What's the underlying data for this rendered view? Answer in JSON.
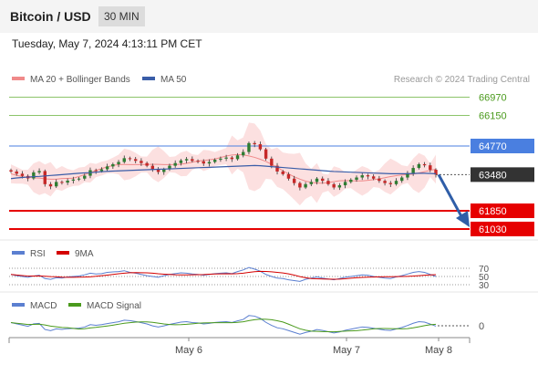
{
  "header": {
    "title": "Bitcoin / USD",
    "timeframe": "30 MIN"
  },
  "datetime": "Tuesday, May 7, 2024 4:13:11 PM CET",
  "legend": [
    {
      "label": "MA 20 + Bollinger Bands",
      "color": "#f08a8a"
    },
    {
      "label": "MA 50",
      "color": "#3a5da8"
    }
  ],
  "watermark": "Research © 2024 Trading Central",
  "chart_data": {
    "type": "candlestick",
    "current_price": 63480,
    "levels": [
      {
        "value": 66970,
        "kind": "resistance",
        "color": "#8cc46a"
      },
      {
        "value": 66150,
        "kind": "resistance",
        "color": "#8cc46a"
      },
      {
        "value": 64770,
        "kind": "pivot",
        "color": "#4a7fe0"
      },
      {
        "value": 61850,
        "kind": "support",
        "color": "#e60000"
      },
      {
        "value": 61030,
        "kind": "support",
        "color": "#e60000"
      }
    ],
    "x_ticks": [
      "May 6",
      "May 7",
      "May 8"
    ],
    "close_path": [
      63620,
      63520,
      63420,
      63310,
      63580,
      63640,
      63050,
      62950,
      63150,
      63120,
      63210,
      63260,
      63300,
      63430,
      63680,
      63640,
      63720,
      63850,
      63950,
      64050,
      64220,
      64180,
      64100,
      64000,
      63880,
      63700,
      63600,
      63720,
      63880,
      64000,
      64120,
      64180,
      64100,
      64080,
      63980,
      64050,
      64150,
      64200,
      64250,
      64180,
      64350,
      64500,
      64900,
      64850,
      64620,
      64200,
      63880,
      63620,
      63500,
      63300,
      63100,
      62900,
      63050,
      63150,
      63300,
      63200,
      63050,
      62900,
      63000,
      63150,
      63250,
      63350,
      63450,
      63400,
      63300,
      63200,
      63100,
      63050,
      63200,
      63350,
      63550,
      63780,
      63950,
      63900,
      63700,
      63480
    ],
    "ma50": [
      63300,
      63330,
      63350,
      63370,
      63390,
      63400,
      63420,
      63440,
      63460,
      63480,
      63500,
      63520,
      63540,
      63560,
      63570,
      63590,
      63610,
      63630,
      63640,
      63650,
      63660,
      63670,
      63680,
      63690,
      63700,
      63710,
      63720,
      63730,
      63740,
      63750,
      63760,
      63770,
      63780,
      63790,
      63800,
      63810,
      63820,
      63830,
      63840,
      63850,
      63860,
      63870,
      63880,
      63890,
      63880,
      63860,
      63840,
      63820,
      63800,
      63780,
      63760,
      63740,
      63720,
      63700,
      63680,
      63660,
      63640,
      63620,
      63610,
      63600,
      63590,
      63580,
      63570,
      63560,
      63550,
      63540,
      63530,
      63520,
      63520,
      63520,
      63520,
      63530,
      63540,
      63540,
      63530,
      63520
    ],
    "projection": {
      "from": 63480,
      "to": 61030
    },
    "rsi": {
      "series": [
        {
          "name": "RSI",
          "color": "#5b7fd0"
        },
        {
          "name": "9MA",
          "color": "#d40000"
        }
      ],
      "levels": [
        70,
        50,
        30
      ],
      "values": [
        55,
        52,
        50,
        48,
        51,
        53,
        45,
        43,
        47,
        46,
        49,
        50,
        51,
        54,
        58,
        56,
        57,
        60,
        61,
        62,
        64,
        60,
        58,
        55,
        52,
        50,
        48,
        52,
        55,
        57,
        59,
        58,
        56,
        55,
        53,
        55,
        57,
        58,
        59,
        57,
        62,
        66,
        72,
        68,
        63,
        55,
        50,
        46,
        45,
        42,
        40,
        38,
        43,
        46,
        49,
        46,
        44,
        42,
        45,
        48,
        50,
        52,
        54,
        53,
        50,
        48,
        46,
        45,
        49,
        52,
        56,
        60,
        62,
        60,
        55,
        50
      ]
    },
    "macd": {
      "series": [
        {
          "name": "MACD",
          "color": "#5b7fd0"
        },
        {
          "name": "MACD Signal",
          "color": "#4a9a1c"
        }
      ],
      "zero_label": "0"
    }
  }
}
